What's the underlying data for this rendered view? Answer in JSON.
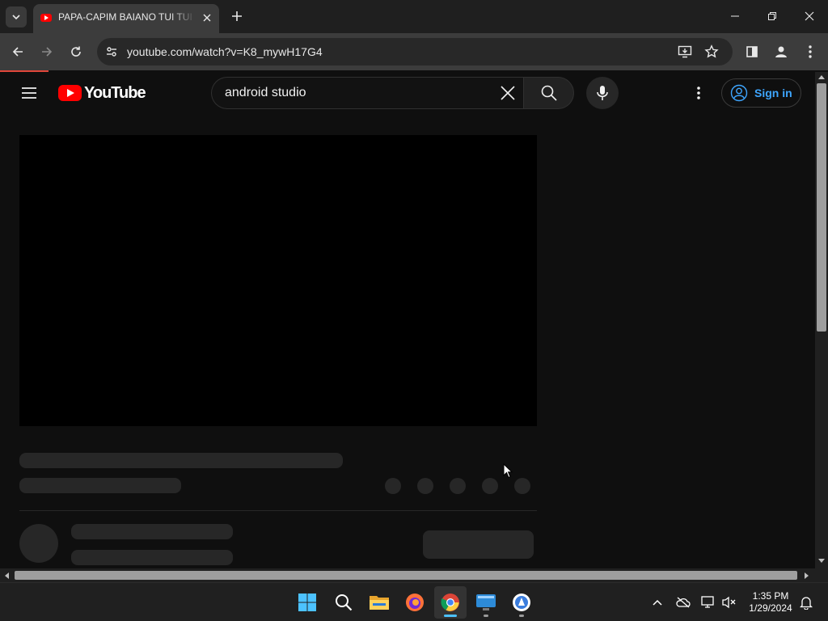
{
  "browser": {
    "tab": {
      "title": "PAPA-CAPIM BAIANO TUI TUI FI"
    },
    "url": "youtube.com/watch?v=K8_mywH17G4"
  },
  "youtube": {
    "logo_text": "YouTube",
    "search": {
      "value": "android studio"
    },
    "signin_label": "Sign in"
  },
  "taskbar": {
    "apps": [
      "windows-start",
      "search",
      "file-explorer",
      "firefox",
      "chrome",
      "remote-desktop",
      "app-installer"
    ],
    "clock": {
      "time": "1:35 PM",
      "date": "1/29/2024"
    }
  },
  "colors": {
    "page_background": "#0f0f0f",
    "youtube_red": "#ff0000",
    "signin_blue": "#3ea6ff",
    "skeleton": "#272727"
  }
}
